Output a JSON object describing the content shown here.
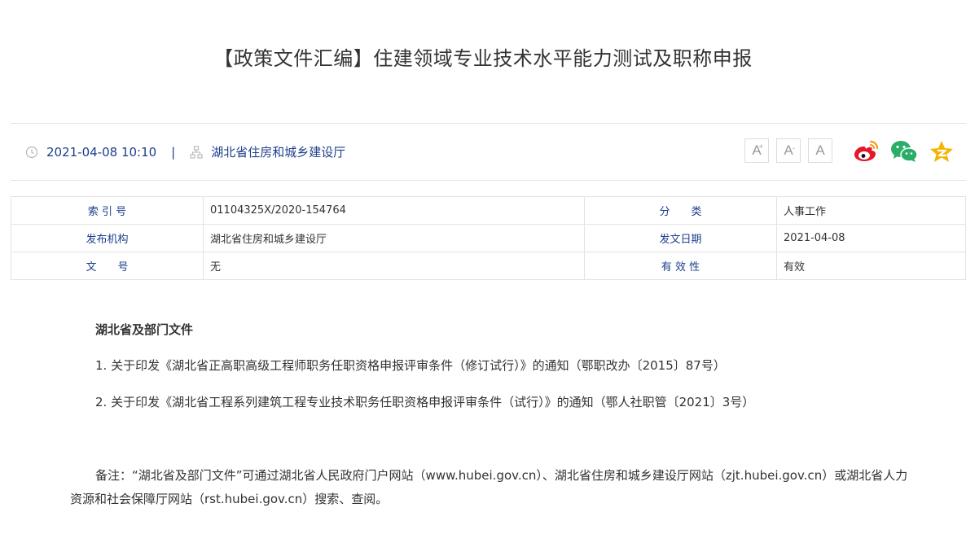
{
  "page": {
    "title": "【政策文件汇编】住建领域专业技术水平能力测试及职称申报"
  },
  "meta": {
    "datetime": "2021-04-08 10:10",
    "separator": "|",
    "source": "湖北省住房和城乡建设厅",
    "font_buttons": [
      "A",
      "A",
      "A"
    ],
    "share_icons": [
      "weibo-icon",
      "wechat-icon",
      "qzone-icon"
    ],
    "colors": {
      "link": "#1d3f8c",
      "weibo": "#e6162d",
      "wechat": "#2aae67",
      "qzone": "#f5b400"
    }
  },
  "info_table": {
    "rows": [
      {
        "label1": "索 引 号",
        "value1": "01104325X/2020-154764",
        "label2": "分　　类",
        "value2": "人事工作"
      },
      {
        "label1": "发布机构",
        "value1": "湖北省住房和城乡建设厅",
        "label2": "发文日期",
        "value2": "2021-04-08"
      },
      {
        "label1": "文　　号",
        "value1": "无",
        "label2": "有 效 性",
        "value2": "有效"
      }
    ]
  },
  "content": {
    "section_title": "湖北省及部门文件",
    "items": [
      "1. 关于印发《湖北省正高职高级工程师职务任职资格申报评审条件（修订试行）》的通知（鄂职改办〔2015〕87号）",
      "2. 关于印发《湖北省工程系列建筑工程专业技术职务任职资格申报评审条件（试行）》的通知（鄂人社职管〔2021〕3号）"
    ],
    "note": "备注：“湖北省及部门文件”可通过湖北省人民政府门户网站（www.hubei.gov.cn）、湖北省住房和城乡建设厅网站（zjt.hubei.gov.cn）或湖北省人力资源和社会保障厅网站（rst.hubei.gov.cn）搜索、查阅。"
  }
}
